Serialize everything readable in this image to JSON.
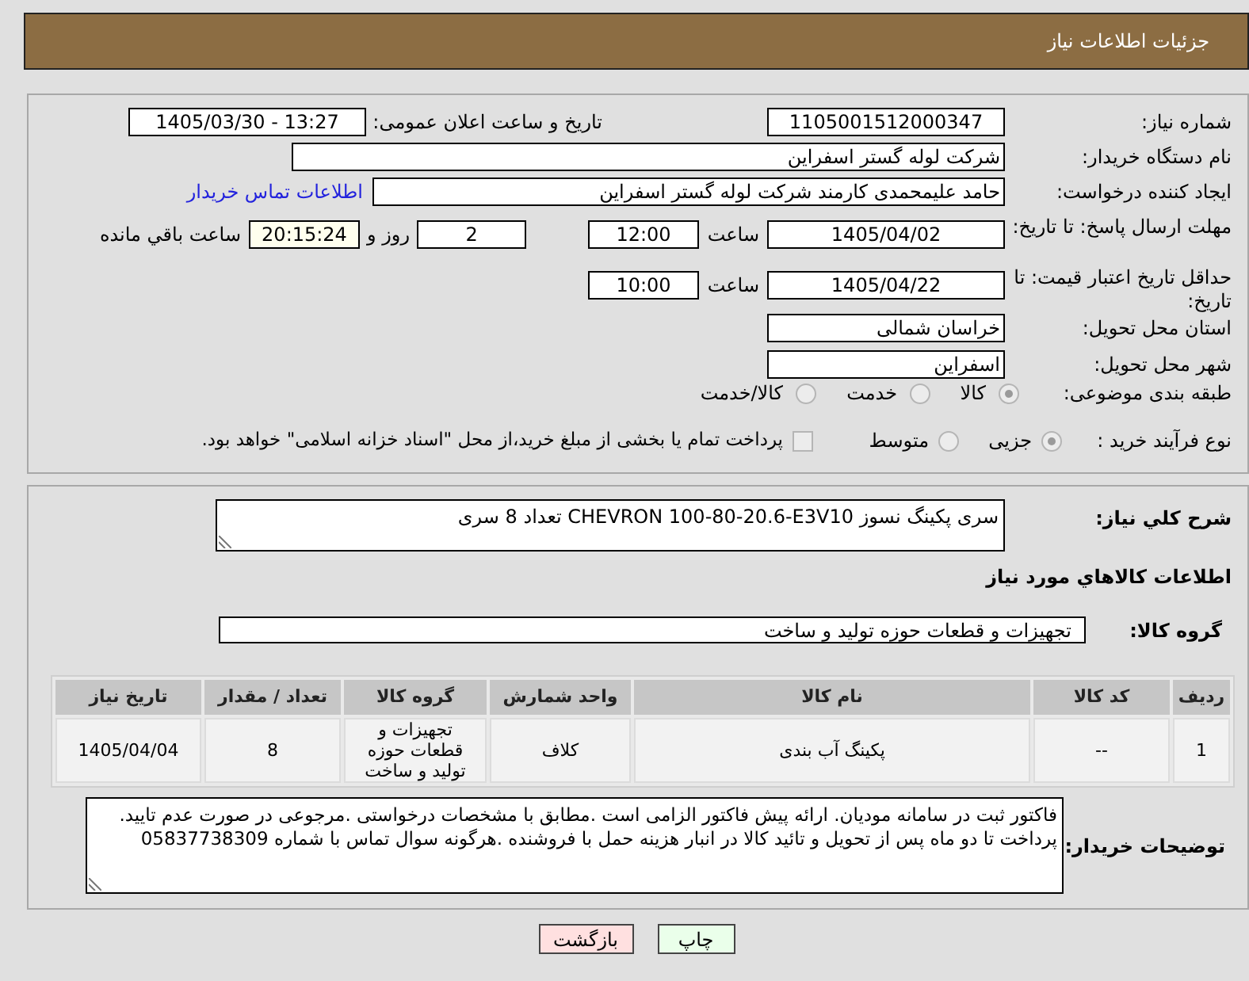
{
  "header": {
    "title": "جزئیات اطلاعات نیاز"
  },
  "details": {
    "need_number": {
      "label": "شماره نیاز:",
      "value": "1105001512000347"
    },
    "announce_datetime": {
      "label": "تاریخ و ساعت اعلان عمومی:",
      "value": "1405/03/30 - 13:27"
    },
    "buyer_org": {
      "label": "نام دستگاه خریدار:",
      "value": "شرکت لوله گستر اسفراین"
    },
    "requester": {
      "label": "ایجاد کننده درخواست:",
      "value": "حامد علیمحمدی کارمند شرکت لوله گستر اسفراین",
      "link": "اطلاعات تماس خریدار"
    },
    "response_deadline": {
      "label": "مهلت ارسال پاسخ: تا تاریخ:",
      "date": "1405/04/02",
      "time_label": "ساعت",
      "time": "12:00",
      "days": "2",
      "days_label": "روز و",
      "remaining": "20:15:24",
      "remaining_label": "ساعت باقي مانده"
    },
    "price_validity": {
      "label": "حداقل تاریخ اعتبار قیمت: تا تاریخ:",
      "date": "1405/04/22",
      "time_label": "ساعت",
      "time": "10:00"
    },
    "delivery_province": {
      "label": "استان محل تحویل:",
      "value": "خراسان شمالی"
    },
    "delivery_city": {
      "label": "شهر محل تحویل:",
      "value": "اسفراین"
    },
    "category": {
      "label": "طبقه بندی موضوعی:",
      "options": [
        {
          "label": "کالا",
          "selected": true,
          "disabled": true
        },
        {
          "label": "خدمت",
          "selected": false,
          "disabled": true
        },
        {
          "label": "کالا/خدمت",
          "selected": false,
          "disabled": true
        }
      ]
    },
    "purchase_type": {
      "label": "نوع فرآیند خرید :",
      "options": [
        {
          "label": "جزیی",
          "selected": true,
          "disabled": true
        },
        {
          "label": "متوسط",
          "selected": false,
          "disabled": true
        }
      ],
      "treasury": {
        "label": "پرداخت تمام یا بخشی از مبلغ خرید،از محل \"اسناد خزانه اسلامی\" خواهد بود.",
        "checked": false,
        "disabled": true
      }
    }
  },
  "summary": {
    "label": "شرح کلي نیاز:",
    "value": "سری پکینگ نسوز CHEVRON 100-80-20.6-E3V10 تعداد 8 سری"
  },
  "items": {
    "title": "اطلاعات کالاهاي مورد نیاز",
    "group": {
      "label": "گروه کالا:",
      "value": "تجهیزات و قطعات حوزه تولید و ساخت"
    },
    "table": {
      "columns": [
        "ردیف",
        "کد کالا",
        "نام کالا",
        "واحد شمارش",
        "گروه کالا",
        "تعداد / مقدار",
        "تاریخ نیاز"
      ],
      "rows": [
        [
          "1",
          "--",
          "پکینگ آب بندی",
          "کلاف",
          "تجهیزات و قطعات حوزه تولید و ساخت",
          "8",
          "1405/04/04"
        ]
      ]
    }
  },
  "buyer_notes": {
    "label": "توضیحات خریدار:",
    "value": "فاکتور ثبت در سامانه مودیان. ارائه پیش فاکتور الزامی است .مطابق با مشخصات درخواستی .مرجوعی در صورت عدم تایید. پرداخت تا دو ماه پس از تحویل و تائید کالا در انبار هزینه حمل با فروشنده .هرگونه سوال تماس با شماره 05837738309"
  },
  "buttons": [
    {
      "label": "چاپ",
      "kind": "print"
    },
    {
      "label": "بازگشت",
      "kind": "back"
    }
  ]
}
